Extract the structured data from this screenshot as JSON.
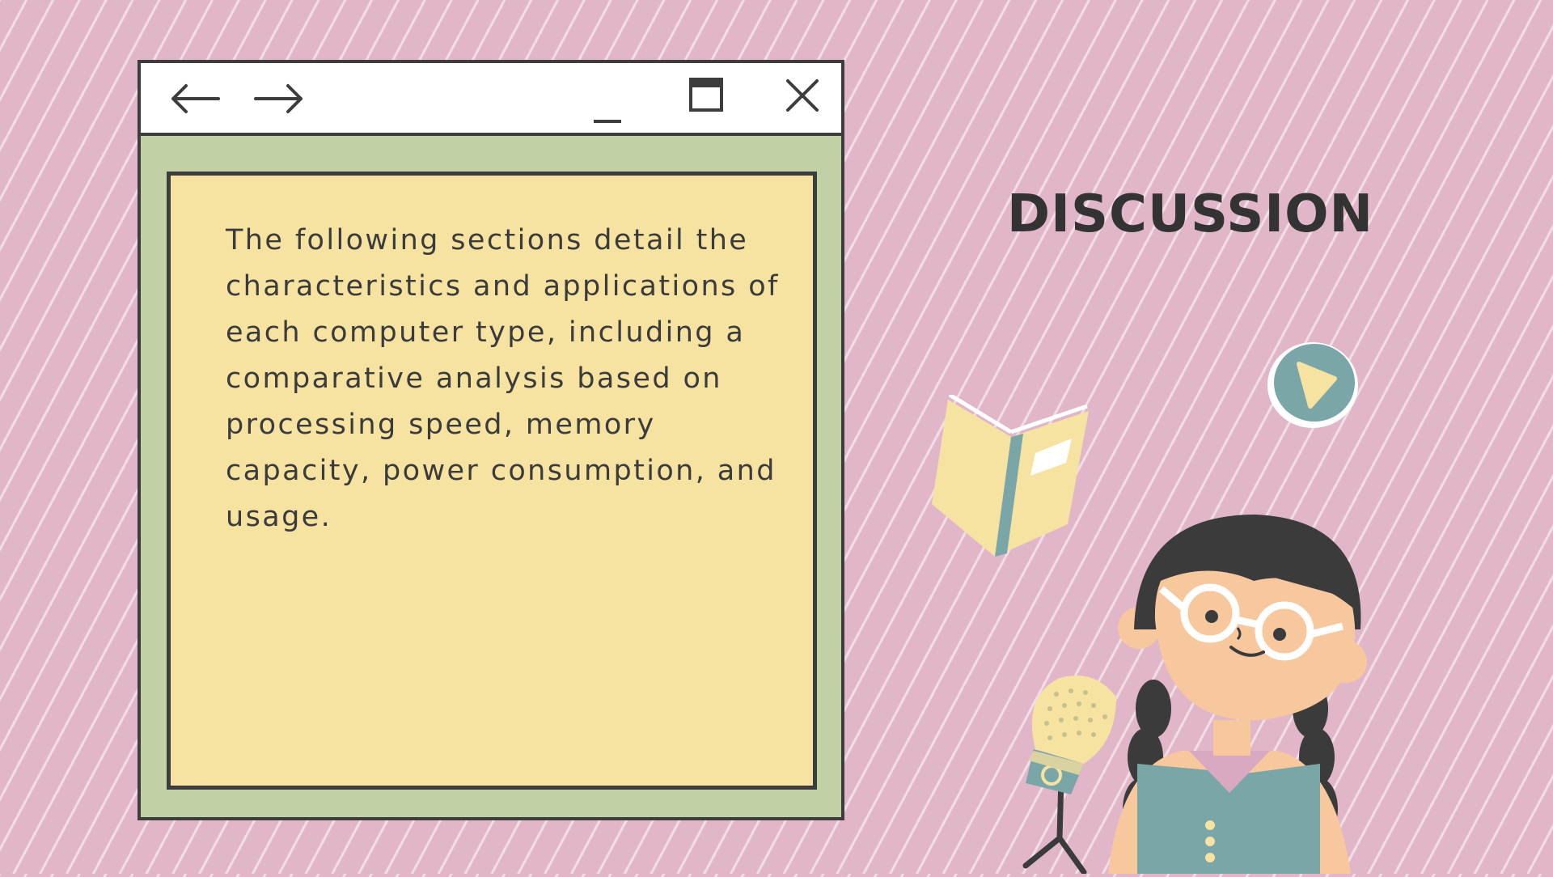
{
  "slide": {
    "heading": "DISCUSSION",
    "body": "The following sections detail the characteristics and applications of each computer type, including a comparative analysis based on processing speed, memory capacity, power consumption, and usage."
  },
  "window_controls": {
    "back": "arrow-left-icon",
    "forward": "arrow-right-icon",
    "minimize": "minimize-icon",
    "maximize": "maximize-icon",
    "close": "close-icon"
  },
  "illustrations": [
    "open-book-icon",
    "play-icon",
    "girl-with-glasses-illustration",
    "microphone-icon"
  ],
  "colors": {
    "background": "#e1b6c9",
    "window_frame": "#c2d1a5",
    "content_panel": "#f6e3a1",
    "text": "#3b3b3b",
    "accent_teal": "#7aa6a8"
  }
}
